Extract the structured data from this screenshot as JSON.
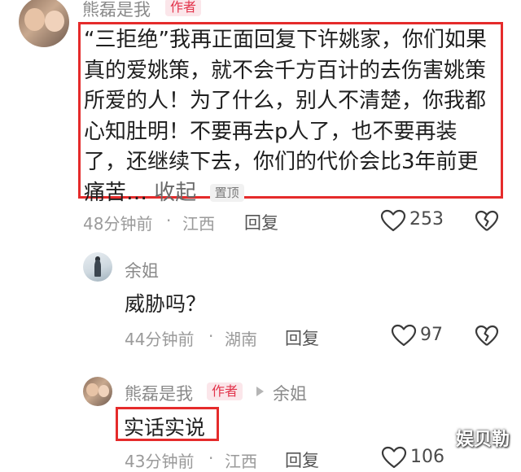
{
  "comment1": {
    "username": "熊磊是我",
    "author_badge": "作者",
    "text": "“三拒绝”我再正面回复下许姚家，你们如果真的爱姚策，就不会千方百计的去伤害姚策所爱的人！为了什么，别人不清楚，你我都心知肚明！不要再去p人了，也不要再装了，还继续下去，你们的代价会比3年前更痛苦…",
    "collapse_label": "收起",
    "pinned_label": "置顶",
    "time": "48分钟前",
    "location": "江西",
    "separator": "·",
    "reply_label": "回复",
    "likes": "253"
  },
  "reply1": {
    "username": "余姐",
    "text": "威胁吗？",
    "time": "44分钟前",
    "location": "湖南",
    "separator": "·",
    "reply_label": "回复",
    "likes": "97"
  },
  "reply2": {
    "username": "熊磊是我",
    "author_badge": "作者",
    "reply_to": "余姐",
    "text": "实话实说",
    "time": "43分钟前",
    "location": "江西",
    "separator": "·",
    "reply_label": "回复",
    "likes": "106"
  },
  "watermark": "娱贝勒",
  "colors": {
    "highlight": "#e52b2b",
    "badge_text": "#e2334b",
    "badge_bg": "#fbe6ea",
    "meta": "#9a9a9a"
  },
  "icons": [
    "heart-icon",
    "broken-heart-icon",
    "reply-arrow-icon"
  ]
}
